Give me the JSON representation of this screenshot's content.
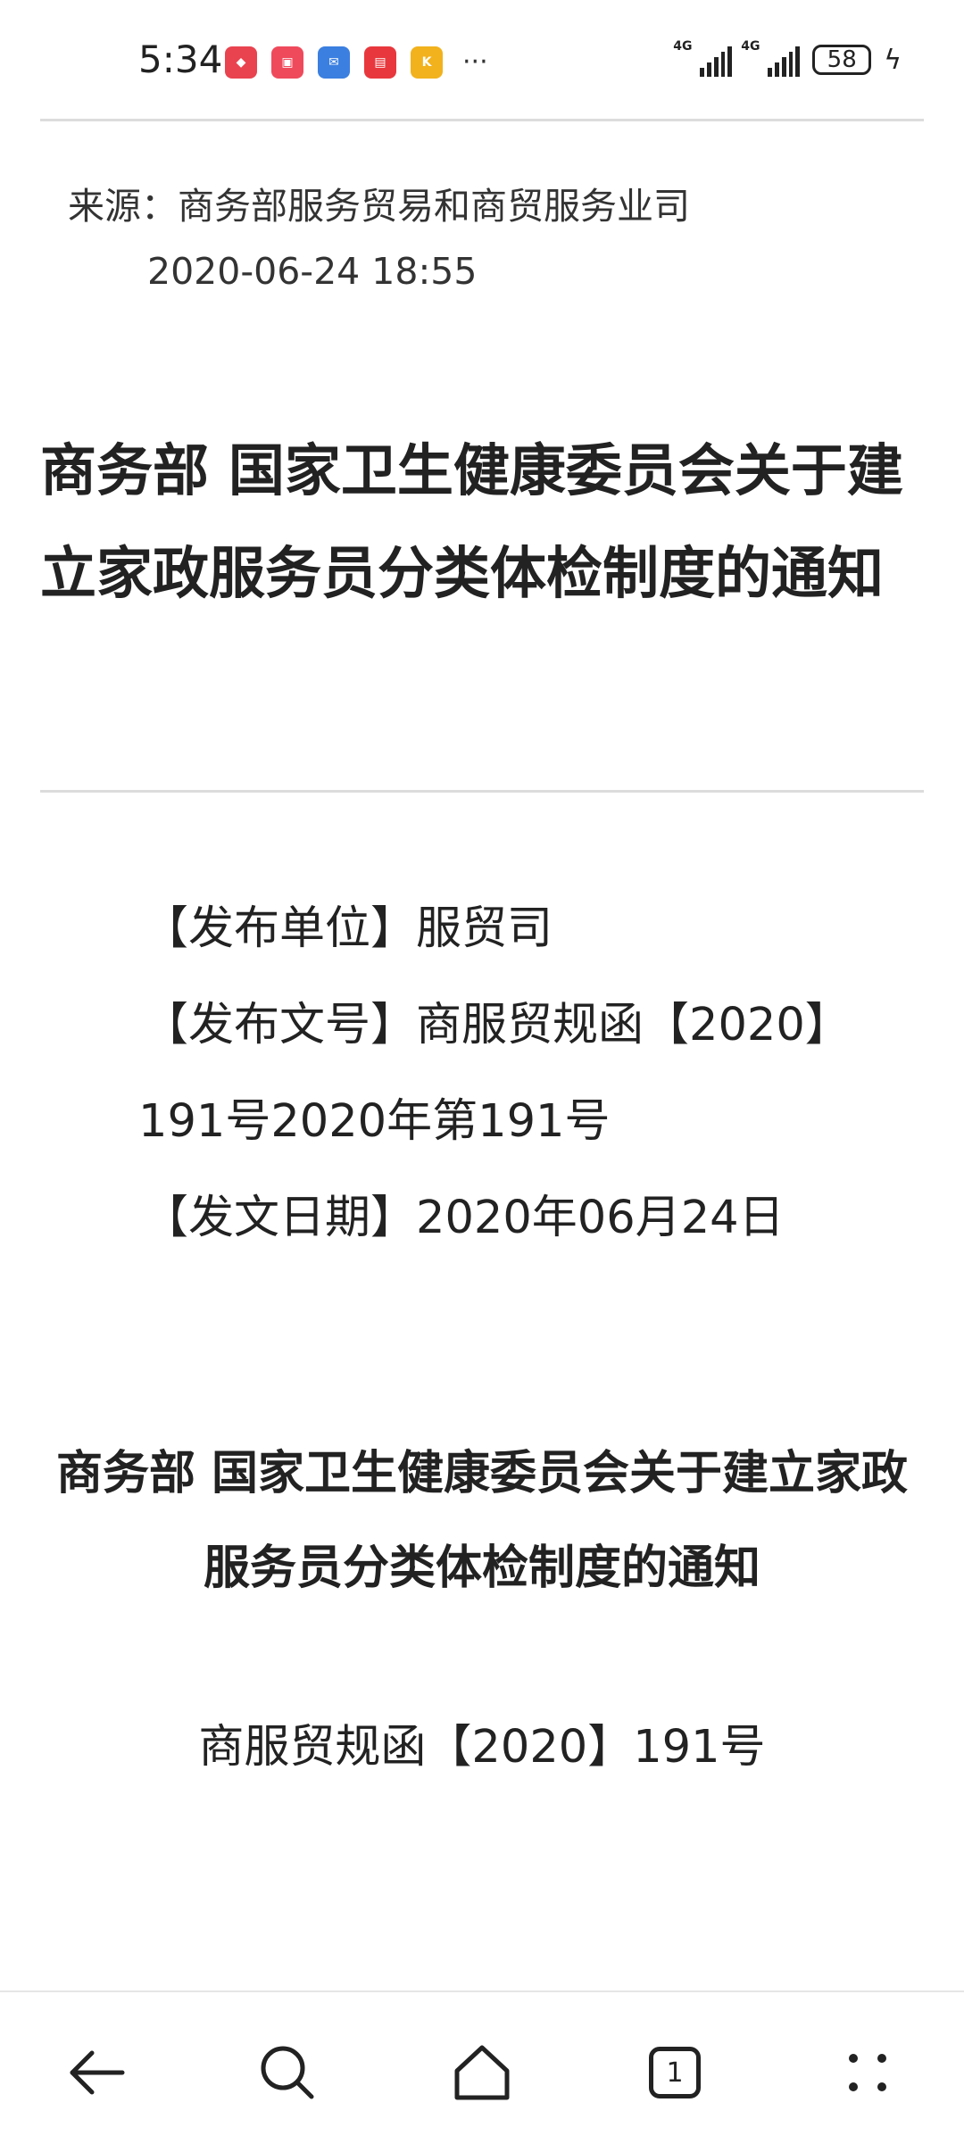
{
  "status_bar": {
    "time": "5:34",
    "app_icons": [
      "huawei-store-icon",
      "notes-icon",
      "mail-icon",
      "reader-icon",
      "kuai-icon"
    ],
    "more": "···",
    "signal_1_label": "4G",
    "signal_2_label": "4G",
    "battery": "58"
  },
  "meta": {
    "source": "来源：商务部服务贸易和商贸服务业司",
    "datetime": "2020-06-24 18:55"
  },
  "article": {
    "title": "商务部 国家卫生健康委员会关于建立家政服务员分类体检制度的通知",
    "info": {
      "publisher": "【发布单位】服贸司",
      "doc_no_line1": "【发布文号】商服贸规函【2020】",
      "doc_no_line2": "191号2020年第191号",
      "date": "【发文日期】2020年06月24日"
    },
    "notice_title": "商务部 国家卫生健康委员会关于建立家政服务员分类体检制度的通知",
    "doc_number": "商服贸规函【2020】191号"
  },
  "bottom_nav": {
    "back": "back-icon",
    "search": "search-icon",
    "home": "home-icon",
    "tabs_count": "1",
    "menu": "menu-icon"
  }
}
